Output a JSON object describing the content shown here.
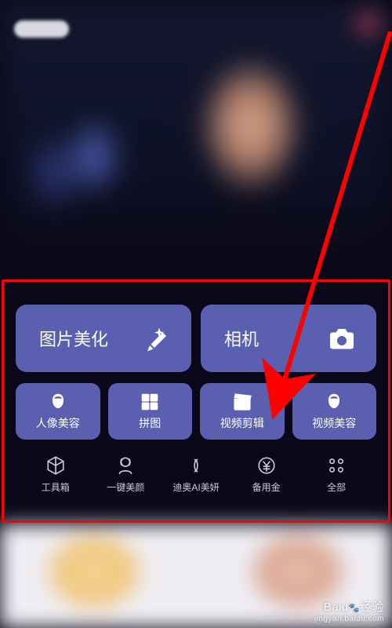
{
  "main_buttons": [
    {
      "label": "图片美化",
      "icon": "wand"
    },
    {
      "label": "相机",
      "icon": "camera"
    }
  ],
  "sub_buttons": [
    {
      "label": "人像美容",
      "icon": "face"
    },
    {
      "label": "拼图",
      "icon": "collage"
    },
    {
      "label": "视频剪辑",
      "icon": "clapper"
    },
    {
      "label": "视频美容",
      "icon": "face"
    }
  ],
  "nav_items": [
    {
      "label": "工具箱",
      "icon": "cube"
    },
    {
      "label": "一键美颜",
      "icon": "lady"
    },
    {
      "label": "迪奥AI美妍",
      "icon": "cd"
    },
    {
      "label": "备用金",
      "icon": "yen"
    },
    {
      "label": "全部",
      "icon": "grid"
    }
  ],
  "annotation": {
    "arrow_target": "视频剪辑"
  },
  "watermark": {
    "brand": "Baid",
    "suffix": "经验",
    "url": "jingyan.baidu.com"
  }
}
